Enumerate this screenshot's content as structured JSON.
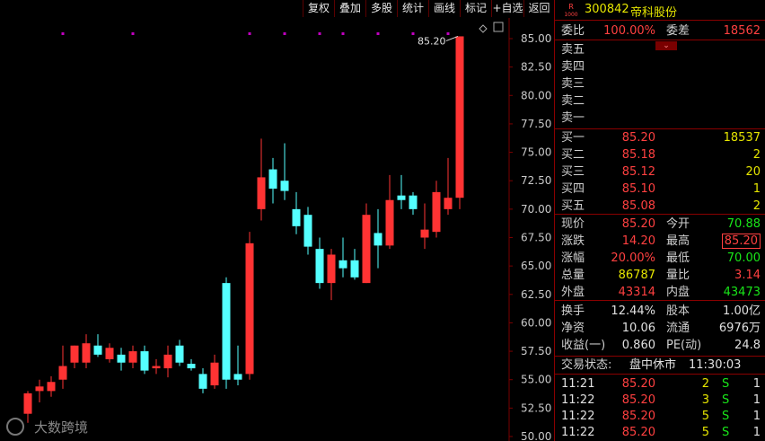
{
  "toolbar": {
    "buttons": [
      "复权",
      "叠加",
      "多股",
      "统计",
      "画线",
      "标记",
      "+自选",
      "返回"
    ]
  },
  "stock": {
    "badge_top": "R",
    "badge_bottom": "1000",
    "code": "300842",
    "name": "帝科股份"
  },
  "order_ratio": {
    "label": "委比",
    "value": "100.00%",
    "diff_label": "委差",
    "diff_value": "18562"
  },
  "asks": [
    {
      "label": "卖五",
      "price": "",
      "volume": ""
    },
    {
      "label": "卖四",
      "price": "",
      "volume": ""
    },
    {
      "label": "卖三",
      "price": "",
      "volume": ""
    },
    {
      "label": "卖二",
      "price": "",
      "volume": ""
    },
    {
      "label": "卖一",
      "price": "",
      "volume": ""
    }
  ],
  "bids": [
    {
      "label": "买一",
      "price": "85.20",
      "volume": "18537"
    },
    {
      "label": "买二",
      "price": "85.18",
      "volume": "2"
    },
    {
      "label": "买三",
      "price": "85.12",
      "volume": "20"
    },
    {
      "label": "买四",
      "price": "85.10",
      "volume": "1"
    },
    {
      "label": "买五",
      "price": "85.08",
      "volume": "2"
    }
  ],
  "stats": [
    {
      "l1": "现价",
      "v1": "85.20",
      "c1": "red",
      "l2": "今开",
      "v2": "70.88",
      "c2": "green"
    },
    {
      "l1": "涨跌",
      "v1": "14.20",
      "c1": "red",
      "l2": "最高",
      "v2": "85.20",
      "c2": "red"
    },
    {
      "l1": "涨幅",
      "v1": "20.00%",
      "c1": "red",
      "l2": "最低",
      "v2": "70.00",
      "c2": "green"
    },
    {
      "l1": "总量",
      "v1": "86787",
      "c1": "yellow",
      "l2": "量比",
      "v2": "3.14",
      "c2": "red"
    },
    {
      "l1": "外盘",
      "v1": "43314",
      "c1": "red",
      "l2": "内盘",
      "v2": "43473",
      "c2": "green"
    }
  ],
  "fundamentals": [
    {
      "l1": "换手",
      "v1": "12.44%",
      "l2": "股本",
      "v2": "1.00亿"
    },
    {
      "l1": "净资",
      "v1": "10.06",
      "l2": "流通",
      "v2": "6976万"
    },
    {
      "l1": "收益(一)",
      "v1": "0.860",
      "l2": "PE(动)",
      "v2": "24.8"
    }
  ],
  "trade_status": {
    "label": "交易状态:",
    "value": "盘中休市",
    "time": "11:30:03"
  },
  "ticks": [
    {
      "time": "11:21",
      "price": "85.20",
      "vol": "2",
      "side": "S",
      "count": "1"
    },
    {
      "time": "11:22",
      "price": "85.20",
      "vol": "3",
      "side": "S",
      "count": "1"
    },
    {
      "time": "11:22",
      "price": "85.20",
      "vol": "5",
      "side": "S",
      "count": "1"
    },
    {
      "time": "11:22",
      "price": "85.20",
      "vol": "5",
      "side": "S",
      "count": "1"
    }
  ],
  "watermark": "大数跨境",
  "colors": {
    "up": "#ff3333",
    "down": "#54ffff",
    "grid": "#7a0000",
    "marker": "#c000c0"
  },
  "chart_data": {
    "type": "candlestick",
    "ylim": [
      50,
      86
    ],
    "yticks": [
      "85.00",
      "82.50",
      "80.00",
      "77.50",
      "75.00",
      "72.50",
      "70.00",
      "67.50",
      "65.00",
      "62.50",
      "60.00",
      "57.50",
      "55.00",
      "52.50",
      "50.00"
    ],
    "last_price_label": "85.20",
    "candles": [
      {
        "o": 52.0,
        "h": 54.0,
        "l": 51.2,
        "c": 53.8
      },
      {
        "o": 54.0,
        "h": 55.0,
        "l": 53.0,
        "c": 54.4
      },
      {
        "o": 54.0,
        "h": 55.3,
        "l": 53.5,
        "c": 54.8
      },
      {
        "o": 55.0,
        "h": 58.0,
        "l": 54.2,
        "c": 56.2
      },
      {
        "o": 56.5,
        "h": 58.0,
        "l": 56.0,
        "c": 58.0
      },
      {
        "o": 56.5,
        "h": 59.0,
        "l": 56.0,
        "c": 58.2
      },
      {
        "o": 58.0,
        "h": 59.0,
        "l": 57.0,
        "c": 57.2
      },
      {
        "o": 56.8,
        "h": 58.2,
        "l": 56.5,
        "c": 57.8
      },
      {
        "o": 57.2,
        "h": 57.8,
        "l": 55.8,
        "c": 56.5
      },
      {
        "o": 56.5,
        "h": 58.0,
        "l": 56.0,
        "c": 57.5
      },
      {
        "o": 57.5,
        "h": 58.0,
        "l": 55.5,
        "c": 55.8
      },
      {
        "o": 56.0,
        "h": 56.8,
        "l": 55.5,
        "c": 56.2
      },
      {
        "o": 56.0,
        "h": 58.0,
        "l": 55.2,
        "c": 57.2
      },
      {
        "o": 58.0,
        "h": 58.5,
        "l": 56.2,
        "c": 56.5
      },
      {
        "o": 56.4,
        "h": 56.8,
        "l": 55.8,
        "c": 56.0
      },
      {
        "o": 55.5,
        "h": 56.0,
        "l": 53.8,
        "c": 54.2
      },
      {
        "o": 54.5,
        "h": 57.2,
        "l": 54.2,
        "c": 56.5
      },
      {
        "o": 63.5,
        "h": 64.0,
        "l": 54.2,
        "c": 55.0
      },
      {
        "o": 55.5,
        "h": 58.0,
        "l": 54.5,
        "c": 55.0
      },
      {
        "o": 55.5,
        "h": 68.0,
        "l": 55.0,
        "c": 67.0
      },
      {
        "o": 70.0,
        "h": 76.2,
        "l": 69.0,
        "c": 72.8
      },
      {
        "o": 73.5,
        "h": 74.5,
        "l": 70.5,
        "c": 71.8
      },
      {
        "o": 72.5,
        "h": 75.8,
        "l": 70.8,
        "c": 71.6
      },
      {
        "o": 70.0,
        "h": 71.5,
        "l": 67.8,
        "c": 68.5
      },
      {
        "o": 69.5,
        "h": 70.2,
        "l": 66.0,
        "c": 66.7
      },
      {
        "o": 66.5,
        "h": 67.5,
        "l": 63.0,
        "c": 63.5
      },
      {
        "o": 63.5,
        "h": 66.5,
        "l": 62.0,
        "c": 66.0
      },
      {
        "o": 65.5,
        "h": 67.5,
        "l": 64.0,
        "c": 64.8
      },
      {
        "o": 65.5,
        "h": 66.5,
        "l": 63.8,
        "c": 64.0
      },
      {
        "o": 63.5,
        "h": 70.5,
        "l": 63.5,
        "c": 69.5
      },
      {
        "o": 67.9,
        "h": 70.0,
        "l": 64.8,
        "c": 66.8
      },
      {
        "o": 66.8,
        "h": 73.0,
        "l": 66.5,
        "c": 70.8
      },
      {
        "o": 71.2,
        "h": 73.0,
        "l": 70.0,
        "c": 70.8
      },
      {
        "o": 71.2,
        "h": 71.5,
        "l": 69.5,
        "c": 70.0
      },
      {
        "o": 67.5,
        "h": 70.5,
        "l": 66.5,
        "c": 68.2
      },
      {
        "o": 68.0,
        "h": 72.5,
        "l": 67.5,
        "c": 71.5
      },
      {
        "o": 70.0,
        "h": 74.5,
        "l": 69.5,
        "c": 71.0
      },
      {
        "o": 71.0,
        "h": 85.2,
        "l": 70.0,
        "c": 85.2
      }
    ],
    "markers": [
      3,
      9,
      19,
      22,
      25,
      27,
      30,
      33,
      36
    ]
  }
}
